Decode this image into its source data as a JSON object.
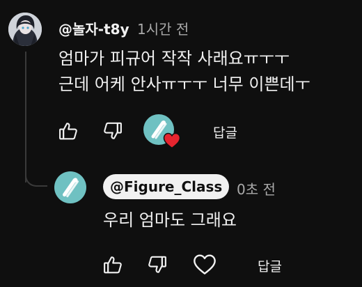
{
  "comment": {
    "author": "@놀자-t8y",
    "time": "1시간 전",
    "text": "엄마가 피규어 작작 사래요ㅠㅜㅜ\n근데 어케 안사ㅠㅜㅜ 너무 이쁜데ㅜ",
    "actions": {
      "like_icon": "thumbs-up-icon",
      "dislike_icon": "thumbs-down-icon",
      "creator_heart": "creator-heart-icon",
      "reply_label": "답글"
    }
  },
  "reply": {
    "author": "@Figure_Class",
    "time": "0초 전",
    "text": "우리 엄마도 그래요",
    "actions": {
      "like_icon": "thumbs-up-icon",
      "dislike_icon": "thumbs-down-icon",
      "heart_icon": "heart-outline-icon",
      "reply_label": "답글"
    }
  },
  "colors": {
    "background": "#0f0f0f",
    "text": "#f1f1f1",
    "muted": "#aaaaaa",
    "channel_avatar": "#6fc1c2",
    "heart": "#e5252f"
  }
}
